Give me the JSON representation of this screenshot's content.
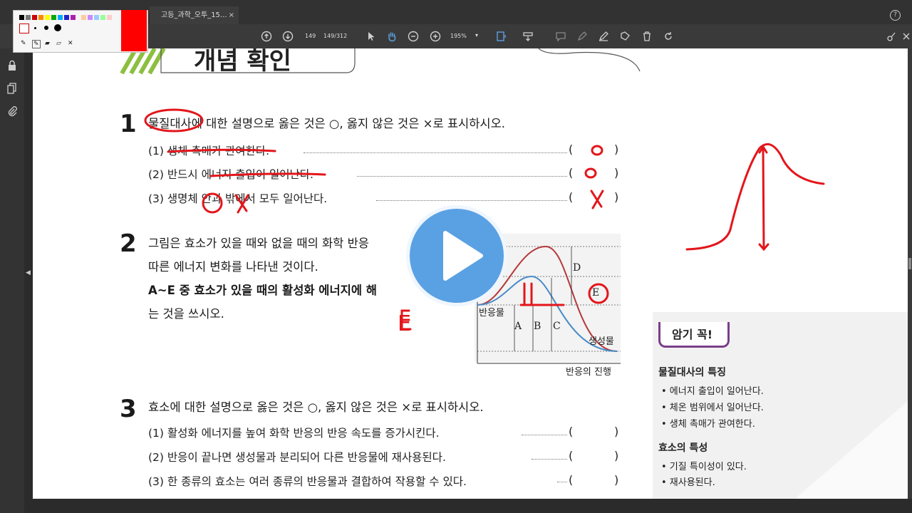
{
  "window": {
    "tab_title": "고등_과학_오투_15...",
    "tab_close": "×",
    "help": "?"
  },
  "toolbar": {
    "page_current": "149",
    "page_total": "149/312",
    "zoom": "195%",
    "zoom_caret": "▾"
  },
  "document": {
    "header_partial": "개념 확인",
    "q1": {
      "number": "1",
      "text": "물질대사에 대한 설명으로 옳은 것은 ○, 옳지 않은 것은 ×로 표시하시오.",
      "items": [
        {
          "label": "(1) 생체 촉매가 관여한다.",
          "answer": "O"
        },
        {
          "label": "(2) 반드시 에너지 출입이 일어난다.",
          "answer": "O"
        },
        {
          "label": "(3) 생명체 안과 밖에서 모두 일어난다.",
          "answer": "X"
        }
      ]
    },
    "q2": {
      "number": "2",
      "lines": [
        "그림은 효소가 있을 때와 없을 때의 화학 반응",
        "따른 에너지 변화를 나타낸 것이다.",
        "A~E 중 효소가 있을 때의 활성화 에너지에 해",
        "는 것을 쓰시오."
      ],
      "handwritten_answer": "E",
      "graph": {
        "reactant_label": "반응물",
        "product_label": "생성물",
        "x_label": "반응의 진행",
        "letters": [
          "A",
          "B",
          "C",
          "D",
          "E"
        ]
      }
    },
    "q3": {
      "number": "3",
      "text": "효소에 대한 설명으로 옳은 것은 ○, 옳지 않은 것은 ×로 표시하시오.",
      "items": [
        {
          "label": "(1) 활성화 에너지를 높여 화학 반응의 반응 속도를 증가시킨다."
        },
        {
          "label": "(2) 반응이 끝나면 생성물과 분리되어 다른 반응물에 재사용된다."
        },
        {
          "label": "(3) 한 종류의 효소는 여러 종류의 반응물과 결합하여 작용할 수 있다."
        }
      ]
    },
    "memo": {
      "badge": "암기 꼭!",
      "section1_title": "물질대사의 특징",
      "section1_items": [
        "• 에너지 출입이 일어난다.",
        "• 체온 범위에서 일어난다.",
        "• 생체 촉매가 관여한다."
      ],
      "section2_title": "효소의 특성",
      "section2_items": [
        "• 기질 특이성이 있다.",
        "• 재사용된다."
      ]
    }
  },
  "colors": {
    "annotation_red": "#e3161b",
    "play_blue": "#5aa1e3",
    "memo_purple": "#7a3f8a",
    "curve_red": "#b5383a",
    "curve_blue": "#4a8cc8"
  }
}
